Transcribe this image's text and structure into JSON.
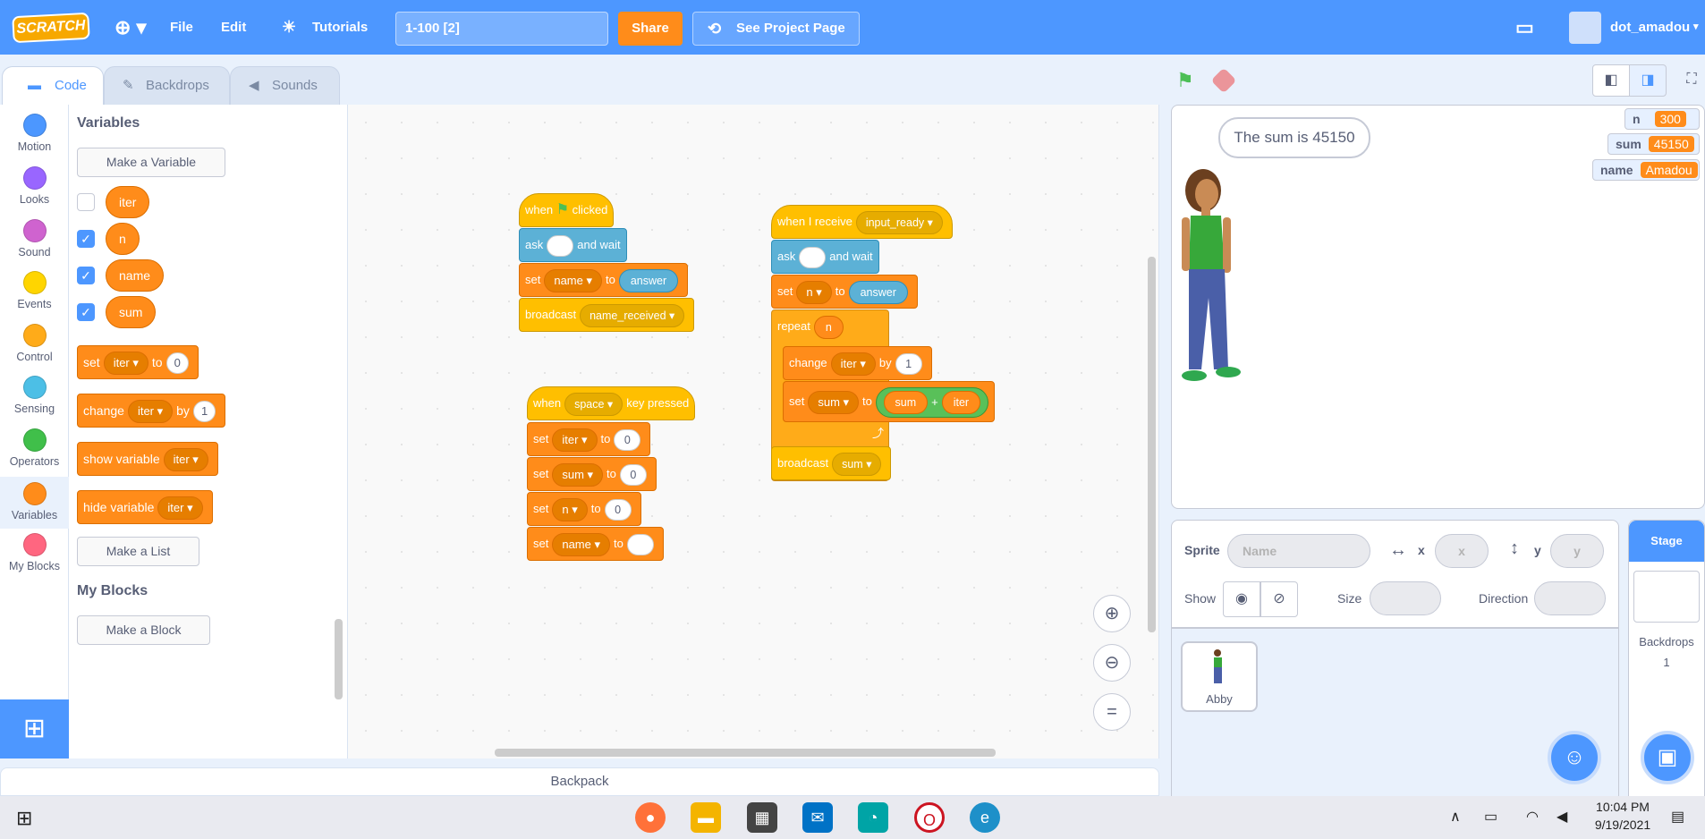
{
  "menu": {
    "logo": "SCRATCH",
    "file": "File",
    "edit": "Edit",
    "tutorials": "Tutorials",
    "project_title": "1-100 [2]",
    "share": "Share",
    "see_project": "See Project Page",
    "username": "dot_amadou"
  },
  "tabs": {
    "code": "Code",
    "backdrops": "Backdrops",
    "sounds": "Sounds"
  },
  "categories": [
    {
      "label": "Motion",
      "color": "#4c97ff"
    },
    {
      "label": "Looks",
      "color": "#9966ff"
    },
    {
      "label": "Sound",
      "color": "#cf63cf"
    },
    {
      "label": "Events",
      "color": "#ffd500"
    },
    {
      "label": "Control",
      "color": "#ffab19"
    },
    {
      "label": "Sensing",
      "color": "#4cbfe6"
    },
    {
      "label": "Operators",
      "color": "#40bf4a"
    },
    {
      "label": "Variables",
      "color": "#ff8c1a"
    },
    {
      "label": "My Blocks",
      "color": "#ff6680"
    }
  ],
  "palette": {
    "heading": "Variables",
    "make_variable": "Make a Variable",
    "variables": [
      {
        "name": "iter",
        "checked": false
      },
      {
        "name": "n",
        "checked": true
      },
      {
        "name": "name",
        "checked": true
      },
      {
        "name": "sum",
        "checked": true
      }
    ],
    "set_block": {
      "kw": "set",
      "var": "iter",
      "to": "to",
      "val": "0"
    },
    "change_block": {
      "kw": "change",
      "var": "iter",
      "by": "by",
      "val": "1"
    },
    "show_block": {
      "kw": "show variable",
      "var": "iter"
    },
    "hide_block": {
      "kw": "hide variable",
      "var": "iter"
    },
    "make_list": "Make a List",
    "myblocks_heading": "My Blocks",
    "make_block": "Make a Block"
  },
  "script1": {
    "when": "when",
    "clicked": "clicked",
    "ask": "ask",
    "and_wait": "and wait",
    "set": "set",
    "set_var": "name",
    "to": "to",
    "answer": "answer",
    "broadcast": "broadcast",
    "broadcast_msg": "name_received"
  },
  "script2": {
    "when": "when",
    "key": "space",
    "key_pressed": "key pressed",
    "rows": [
      {
        "kw": "set",
        "var": "iter",
        "to": "to",
        "val": "0"
      },
      {
        "kw": "set",
        "var": "sum",
        "to": "to",
        "val": "0"
      },
      {
        "kw": "set",
        "var": "n",
        "to": "to",
        "val": "0"
      },
      {
        "kw": "set",
        "var": "name",
        "to": "to",
        "val": ""
      }
    ]
  },
  "script3": {
    "when_receive": "when I receive",
    "msg": "input_ready",
    "ask": "ask",
    "and_wait": "and wait",
    "set": "set",
    "set_var": "n",
    "to": "to",
    "answer": "answer",
    "repeat": "repeat",
    "repeat_var": "n",
    "change": "change",
    "change_var": "iter",
    "by": "by",
    "change_val": "1",
    "set2": "set",
    "set2_var": "sum",
    "to2": "to",
    "op_left": "sum",
    "op": "+",
    "op_right": "iter",
    "broadcast": "broadcast",
    "broadcast_msg": "sum"
  },
  "backpack": "Backpack",
  "stage": {
    "speech": "The sum is 45150",
    "monitors": [
      {
        "label": "n",
        "value": "300"
      },
      {
        "label": "sum",
        "value": "45150"
      },
      {
        "label": "name",
        "value": "Amadou"
      }
    ]
  },
  "sprite_info": {
    "sprite_label": "Sprite",
    "name_placeholder": "Name",
    "x_label": "x",
    "x_placeholder": "x",
    "y_label": "y",
    "y_placeholder": "y",
    "show_label": "Show",
    "size_label": "Size",
    "direction_label": "Direction"
  },
  "sprites": [
    {
      "name": "Abby"
    }
  ],
  "stage_panel": {
    "title": "Stage",
    "backdrops_label": "Backdrops",
    "backdrops_count": "1"
  },
  "taskbar": {
    "time": "10:04 PM",
    "date": "9/19/2021"
  }
}
